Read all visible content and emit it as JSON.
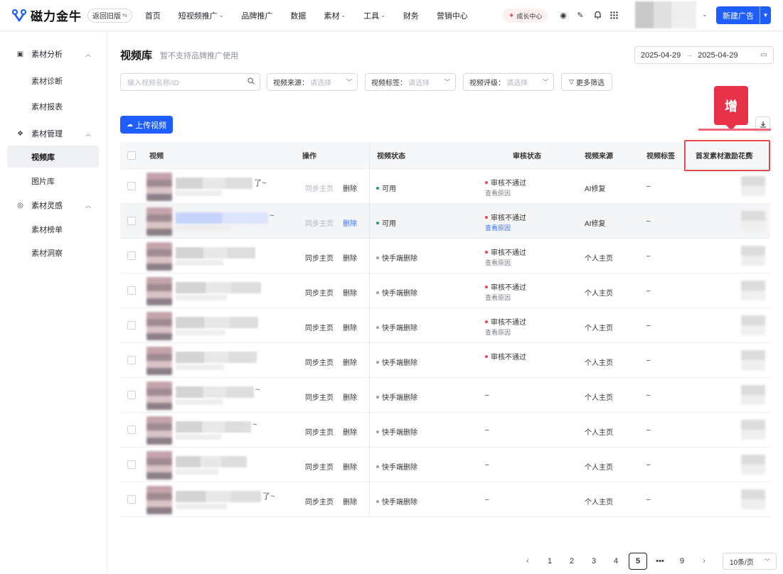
{
  "app": {
    "logo_text": "磁力金牛",
    "old_version": "返回旧版"
  },
  "nav": [
    {
      "label": "首页",
      "has_menu": false
    },
    {
      "label": "短视频推广",
      "has_menu": true
    },
    {
      "label": "品牌推广",
      "has_menu": false
    },
    {
      "label": "数据",
      "has_menu": false
    },
    {
      "label": "素材",
      "has_menu": true
    },
    {
      "label": "工具",
      "has_menu": true
    },
    {
      "label": "财务",
      "has_menu": false
    },
    {
      "label": "营销中心",
      "has_menu": false
    }
  ],
  "topbar": {
    "growth_center": "成长中心",
    "new_ad": "新建广告"
  },
  "sidebar": {
    "groups": [
      {
        "label": "素材分析",
        "icon": "monitor-icon",
        "items": [
          "素材诊断",
          "素材报表"
        ]
      },
      {
        "label": "素材管理",
        "icon": "gear-icon",
        "items": [
          "视频库",
          "图片库"
        ]
      },
      {
        "label": "素材灵感",
        "icon": "bulb-icon",
        "items": [
          "素材榜单",
          "素材洞察"
        ]
      }
    ],
    "active_item": "视频库"
  },
  "page": {
    "title": "视频库",
    "subtitle": "暂不支持品牌推广使用",
    "date_start": "2025-04-29",
    "date_end": "2025-04-29"
  },
  "filters": {
    "search_placeholder": "输入视频名称/ID",
    "source_label": "视频来源：",
    "tag_label": "视频标签：",
    "rating_label": "视频评级：",
    "select_placeholder": "请选择",
    "more": "更多筛选"
  },
  "upload_label": "上传视频",
  "annotation": {
    "badge": "增"
  },
  "columns": {
    "video": "视频",
    "ops": "操作",
    "status": "视频状态",
    "audit": "审核状态",
    "source": "视频来源",
    "tags": "视频标签",
    "spend": "首发素材激励花费"
  },
  "ops": {
    "sync": "同步主页",
    "delete": "删除"
  },
  "audit_reason": "查看原因",
  "rows": [
    {
      "status": "可用",
      "status_color": "#22a06b",
      "audit": "审核不通过",
      "reason": true,
      "source": "AI修复",
      "tag": "–",
      "ops_disabled": true,
      "hover": false,
      "tilde": "了~"
    },
    {
      "status": "可用",
      "status_color": "#22a06b",
      "audit": "审核不通过",
      "reason": true,
      "source": "AI修复",
      "tag": "–",
      "ops_disabled": true,
      "hover": true,
      "tilde": "~"
    },
    {
      "status": "快手端删除",
      "status_color": "#9aa0a8",
      "audit": "审核不通过",
      "reason": true,
      "source": "个人主页",
      "tag": "–",
      "ops_disabled": false,
      "hover": false,
      "tilde": ""
    },
    {
      "status": "快手端删除",
      "status_color": "#9aa0a8",
      "audit": "审核不通过",
      "reason": true,
      "source": "个人主页",
      "tag": "–",
      "ops_disabled": false,
      "hover": false,
      "tilde": ""
    },
    {
      "status": "快手端删除",
      "status_color": "#9aa0a8",
      "audit": "审核不通过",
      "reason": true,
      "source": "个人主页",
      "tag": "–",
      "ops_disabled": false,
      "hover": false,
      "tilde": ""
    },
    {
      "status": "快手端删除",
      "status_color": "#9aa0a8",
      "audit": "审核不通过",
      "reason": false,
      "source": "个人主页",
      "tag": "–",
      "ops_disabled": false,
      "hover": false,
      "tilde": ""
    },
    {
      "status": "快手端删除",
      "status_color": "#9aa0a8",
      "audit": "–",
      "reason": false,
      "source": "个人主页",
      "tag": "–",
      "ops_disabled": false,
      "hover": false,
      "tilde": "~"
    },
    {
      "status": "快手端删除",
      "status_color": "#9aa0a8",
      "audit": "–",
      "reason": false,
      "source": "个人主页",
      "tag": "–",
      "ops_disabled": false,
      "hover": false,
      "tilde": "~"
    },
    {
      "status": "快手端删除",
      "status_color": "#9aa0a8",
      "audit": "–",
      "reason": false,
      "source": "个人主页",
      "tag": "–",
      "ops_disabled": false,
      "hover": false,
      "tilde": ""
    },
    {
      "status": "快手端删除",
      "status_color": "#9aa0a8",
      "audit": "–",
      "reason": false,
      "source": "个人主页",
      "tag": "–",
      "ops_disabled": false,
      "hover": false,
      "tilde": "了~"
    }
  ],
  "pagination": {
    "pages": [
      "1",
      "2",
      "3",
      "4",
      "5",
      "•••",
      "9"
    ],
    "current": "5",
    "page_size": "10条/页"
  }
}
